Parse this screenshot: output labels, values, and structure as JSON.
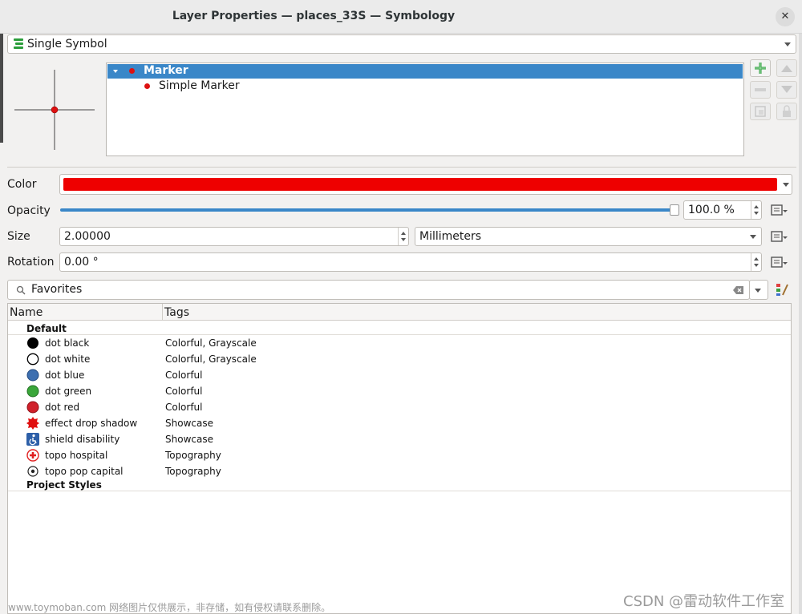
{
  "window": {
    "title": "Layer Properties — places_33S — Symbology",
    "close_glyph": "✕"
  },
  "renderer": {
    "selected": "Single Symbol"
  },
  "symbol_tree": {
    "items": [
      {
        "label": "Marker",
        "selected": true
      },
      {
        "label": "Simple Marker",
        "selected": false
      }
    ]
  },
  "properties": {
    "color": {
      "label": "Color",
      "value": "#ee0000"
    },
    "opacity": {
      "label": "Opacity",
      "value": "100.0 %",
      "fraction": 1.0
    },
    "size": {
      "label": "Size",
      "value": "2.00000",
      "unit": "Millimeters"
    },
    "rotation": {
      "label": "Rotation",
      "value": "0.00 °"
    }
  },
  "library": {
    "search_value": "Favorites",
    "columns": {
      "name": "Name",
      "tags": "Tags"
    },
    "groups": [
      {
        "name": "Default",
        "items": [
          {
            "name": "dot  black",
            "tags": "Colorful, Grayscale",
            "icon": "dot-black-icon"
          },
          {
            "name": "dot  white",
            "tags": "Colorful, Grayscale",
            "icon": "dot-white-icon"
          },
          {
            "name": "dot blue",
            "tags": "Colorful",
            "icon": "dot-blue-icon"
          },
          {
            "name": "dot green",
            "tags": "Colorful",
            "icon": "dot-green-icon"
          },
          {
            "name": "dot red",
            "tags": "Colorful",
            "icon": "dot-red-icon"
          },
          {
            "name": "effect drop shadow",
            "tags": "Showcase",
            "icon": "effect-drop-shadow-icon"
          },
          {
            "name": "shield disability",
            "tags": "Showcase",
            "icon": "shield-disability-icon"
          },
          {
            "name": "topo hospital",
            "tags": "Topography",
            "icon": "topo-hospital-icon"
          },
          {
            "name": "topo pop capital",
            "tags": "Topography",
            "icon": "topo-pop-capital-icon"
          }
        ]
      },
      {
        "name": "Project Styles",
        "items": []
      }
    ]
  },
  "watermarks": {
    "left": "www.toymoban.com 网络图片仅供展示，非存储，如有侵权请联系删除。",
    "right": "CSDN @雷动软件工作室"
  }
}
